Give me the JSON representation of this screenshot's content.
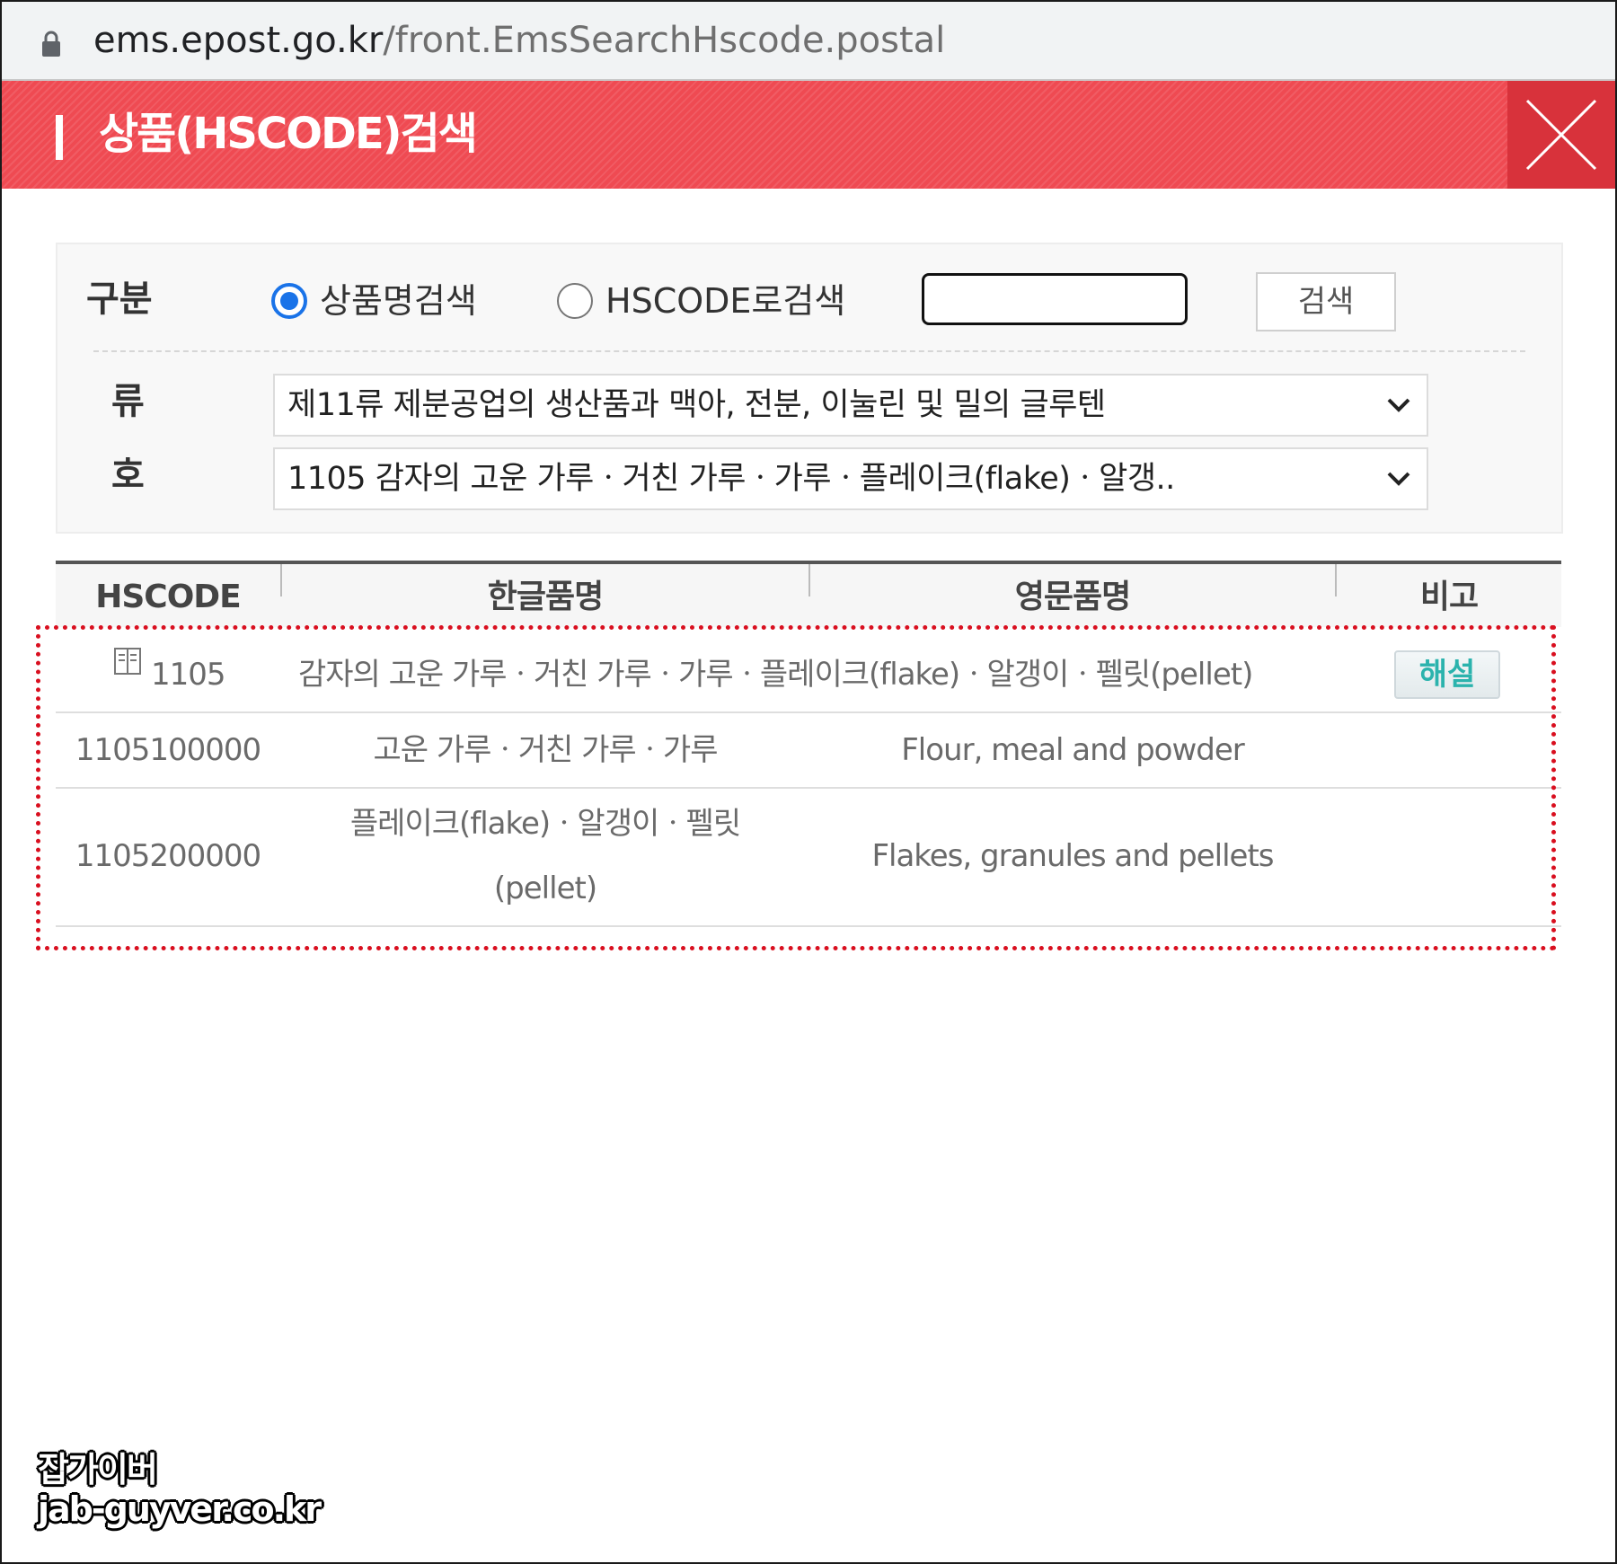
{
  "browser": {
    "url_host": "ems.epost.go.kr",
    "url_path": "/front.EmsSearchHscode.postal"
  },
  "dialog": {
    "title": "상품(HSCODE)검색"
  },
  "search": {
    "label_gubun": "구분",
    "radio_product_name": "상품명검색",
    "radio_hscode": "HSCODE로검색",
    "selected_mode": "product_name",
    "input_value": "",
    "button_label": "검색",
    "label_ryu": "류",
    "label_ho": "호",
    "ryu_selected": "제11류 제분공업의 생산품과 맥아, 전분, 이눌린 및 밀의 글루텐",
    "ho_selected": "1105 감자의 고운 가루ㆍ거친 가루ㆍ가루ㆍ플레이크(flake)ㆍ알갱.."
  },
  "table": {
    "headers": {
      "hscode": "HSCODE",
      "korean_name": "한글품명",
      "english_name": "영문품명",
      "note": "비고"
    },
    "rows": [
      {
        "hscode": "1105",
        "korean_name": "감자의 고운 가루ㆍ거친 가루ㆍ가루ㆍ플레이크(flake)ㆍ알갱이ㆍ펠릿(pellet)",
        "english_name": "",
        "note_button": "해설"
      },
      {
        "hscode": "1105100000",
        "korean_name": "고운 가루ㆍ거친 가루ㆍ가루",
        "english_name": "Flour, meal and powder"
      },
      {
        "hscode": "1105200000",
        "korean_name_line1": "플레이크(flake)ㆍ알갱이ㆍ펠릿",
        "korean_name_line2": "(pellet)",
        "english_name": "Flakes, granules and pellets"
      }
    ]
  },
  "watermark": {
    "line1": "잡가이버",
    "line2": "jab-guyver.co.kr"
  },
  "colors": {
    "title_bar": "#ef4a52",
    "close_button": "#d8323b",
    "radio_accent": "#1a73e8",
    "highlight_border": "#d90f1f",
    "commentary_text": "#2bb3ad"
  },
  "icons": {
    "lock": "lock-icon",
    "close": "close-icon",
    "chevron": "chevron-down-icon",
    "book": "book-icon"
  }
}
